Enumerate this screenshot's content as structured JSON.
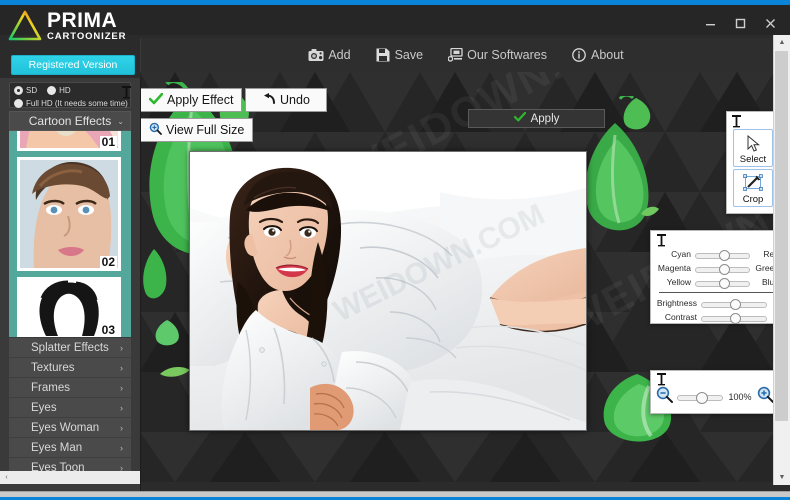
{
  "window": {
    "controls": [
      {
        "name": "minimize",
        "glyph": "—"
      },
      {
        "name": "maximize",
        "glyph": "❐"
      },
      {
        "name": "close",
        "glyph": "✕"
      }
    ]
  },
  "brand": {
    "name": "PRIMA",
    "subtitle": "CARTOONIZER",
    "registered_label": "Registered Version"
  },
  "toolbar": {
    "items": [
      {
        "label": "Add",
        "icon": "camera-icon"
      },
      {
        "label": "Save",
        "icon": "floppy-disk-icon"
      },
      {
        "label": "Our Softwares",
        "icon": "apps-icon"
      },
      {
        "label": "About",
        "icon": "info-icon"
      }
    ]
  },
  "sidebar": {
    "quality": {
      "options": [
        {
          "label": "SD",
          "selected": true
        },
        {
          "label": "HD",
          "selected": false
        },
        {
          "label": "Full HD (It needs some time)",
          "selected": false
        }
      ]
    },
    "category_header": {
      "label": "Cartoon Effects",
      "chevron": "⌄"
    },
    "thumbnails": [
      {
        "number": "01"
      },
      {
        "number": "02"
      },
      {
        "number": "03"
      }
    ],
    "categories": [
      {
        "label": "Splatter Effects",
        "arrow": "›"
      },
      {
        "label": "Textures",
        "arrow": "›"
      },
      {
        "label": "Frames",
        "arrow": "›"
      },
      {
        "label": "Eyes",
        "arrow": "›"
      },
      {
        "label": "Eyes Woman",
        "arrow": "›"
      },
      {
        "label": "Eyes Man",
        "arrow": "›"
      },
      {
        "label": "Eyes Toon",
        "arrow": "›"
      }
    ]
  },
  "actions": {
    "apply_effect": {
      "label": "Apply Effect",
      "icon": "check-icon"
    },
    "undo": {
      "label": "Undo",
      "icon": "undo-arrow-icon"
    },
    "view_full_size": {
      "label": "View Full Size",
      "icon": "magnifier-icon"
    },
    "apply": {
      "label": "Apply",
      "icon": "check-icon"
    }
  },
  "tools_panel": {
    "pin": "pin-icon",
    "tools": [
      {
        "label": "Select",
        "icon": "cursor-arrow-icon"
      },
      {
        "label": "Crop",
        "icon": "crop-icon"
      }
    ]
  },
  "color_panel": {
    "pin": "pin-icon",
    "sliders": [
      {
        "left_label": "Cyan",
        "right_label": "Red",
        "value": 50
      },
      {
        "left_label": "Magenta",
        "right_label": "Green",
        "value": 50
      },
      {
        "left_label": "Yellow",
        "right_label": "Blue",
        "value": 50
      }
    ],
    "adjustments": [
      {
        "left_label": "Brightness",
        "right_label": "",
        "value": 50
      },
      {
        "left_label": "Contrast",
        "right_label": "",
        "value": 50
      }
    ]
  },
  "zoom_panel": {
    "pin": "pin-icon",
    "zoom_out_icon": "magnifier-minus-icon",
    "zoom_in_icon": "magnifier-plus-icon",
    "level": "100%",
    "slider_value": 50
  },
  "watermark": {
    "text": "WWW.WEIDOWN.COM"
  },
  "colors": {
    "accent_blue": "#0a84d8",
    "registered_cyan": "#21c2da",
    "sidebar_teal": "#54a79b",
    "check_green": "#2db82d",
    "panel_dark": "#2b2b2b"
  }
}
